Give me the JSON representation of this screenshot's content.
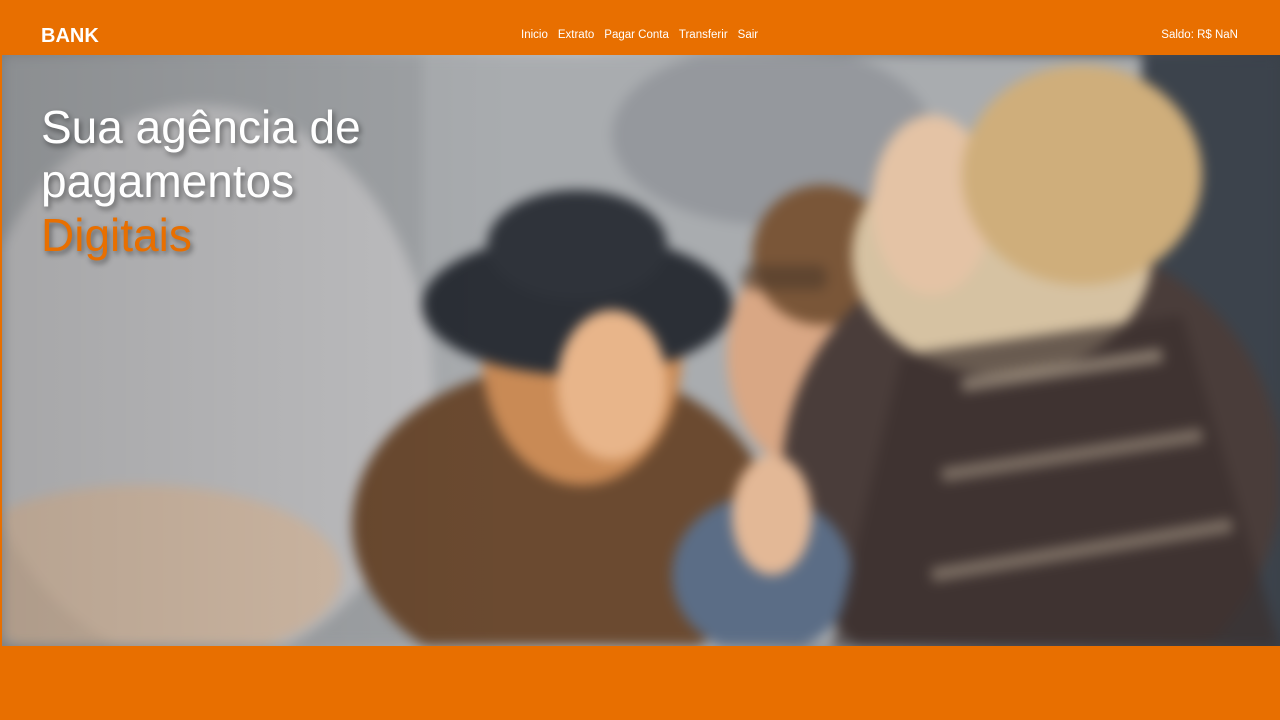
{
  "navbar": {
    "brand": "BANK",
    "links": [
      {
        "label": "Inicio"
      },
      {
        "label": "Extrato"
      },
      {
        "label": "Pagar Conta"
      },
      {
        "label": "Transferir"
      },
      {
        "label": "Sair"
      }
    ],
    "balance_label": "Saldo: R$ NaN"
  },
  "hero": {
    "title_line1": "Sua agência de",
    "title_line2": "pagamentos",
    "title_accent": "Digitais",
    "image": "friends-laughing-photo"
  },
  "colors": {
    "brand_orange": "#e86f00",
    "text_white": "#ffffff"
  }
}
